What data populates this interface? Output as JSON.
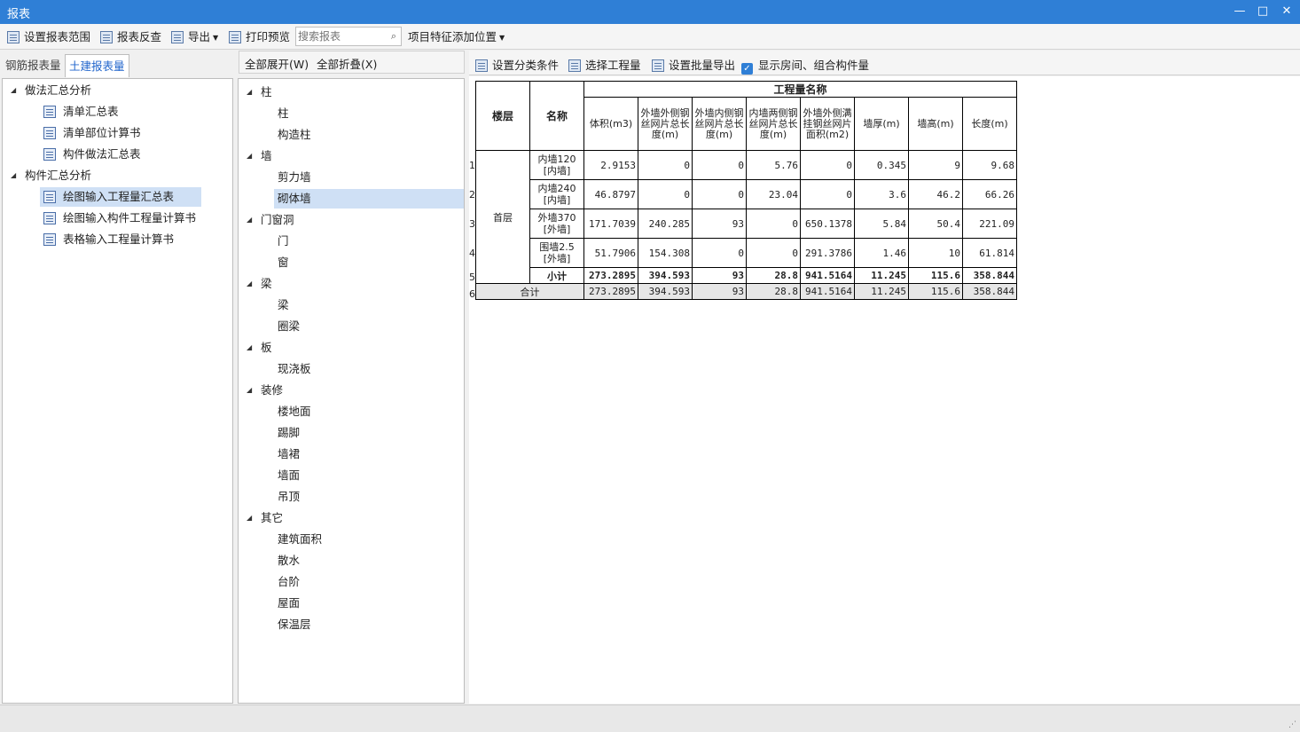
{
  "window": {
    "title": "报表",
    "minimize": "—",
    "maximize": "□",
    "close": "✕"
  },
  "toolbar": {
    "set_range": "设置报表范围",
    "reverse": "报表反查",
    "export": "导出",
    "print_preview": "打印预览",
    "search_placeholder": "搜索报表",
    "feature_position": "项目特征添加位置"
  },
  "left_tabs": {
    "tab1": "钢筋报表量",
    "tab2": "土建报表量"
  },
  "left_tree": {
    "group1": "做法汇总分析",
    "g1_items": [
      "清单汇总表",
      "清单部位计算书",
      "构件做法汇总表"
    ],
    "group2": "构件汇总分析",
    "g2_items": [
      "绘图输入工程量汇总表",
      "绘图输入构件工程量计算书",
      "表格输入工程量计算书"
    ]
  },
  "mid": {
    "expand_all": "全部展开(W)",
    "collapse_all": "全部折叠(X)",
    "tree": [
      {
        "label": "柱",
        "children": [
          "柱",
          "构造柱"
        ]
      },
      {
        "label": "墙",
        "children": [
          "剪力墙",
          "砌体墙"
        ]
      },
      {
        "label": "门窗洞",
        "children": [
          "门",
          "窗"
        ]
      },
      {
        "label": "梁",
        "children": [
          "梁",
          "圈梁"
        ]
      },
      {
        "label": "板",
        "children": [
          "现浇板"
        ]
      },
      {
        "label": "装修",
        "children": [
          "楼地面",
          "踢脚",
          "墙裙",
          "墙面",
          "吊顶"
        ]
      },
      {
        "label": "其它",
        "children": [
          "建筑面积",
          "散水",
          "台阶",
          "屋面",
          "保温层"
        ]
      }
    ]
  },
  "right_toolbar": {
    "classify": "设置分类条件",
    "select_qty": "选择工程量",
    "batch_export": "设置批量导出",
    "show_rooms": "显示房间、组合构件量"
  },
  "report": {
    "h_floor": "楼层",
    "h_name": "名称",
    "h_group": "工程量名称",
    "cols": [
      "体积(m3)",
      "外墙外侧钢丝网片总长度(m)",
      "外墙内侧钢丝网片总长度(m)",
      "内墙两侧钢丝网片总长度(m)",
      "外墙外侧满挂钢丝网片面积(m2)",
      "墙厚(m)",
      "墙高(m)",
      "长度(m)"
    ],
    "floor": "首层",
    "rows": [
      {
        "n": "1",
        "name": "内墙120 [内墙]",
        "v": [
          "2.9153",
          "0",
          "0",
          "5.76",
          "0",
          "0.345",
          "9",
          "9.68"
        ]
      },
      {
        "n": "2",
        "name": "内墙240 [内墙]",
        "v": [
          "46.8797",
          "0",
          "0",
          "23.04",
          "0",
          "3.6",
          "46.2",
          "66.26"
        ]
      },
      {
        "n": "3",
        "name": "外墙370 [外墙]",
        "v": [
          "171.7039",
          "240.285",
          "93",
          "0",
          "650.1378",
          "5.84",
          "50.4",
          "221.09"
        ]
      },
      {
        "n": "4",
        "name": "围墙2.5 [外墙]",
        "v": [
          "51.7906",
          "154.308",
          "0",
          "0",
          "291.3786",
          "1.46",
          "10",
          "61.814"
        ]
      }
    ],
    "subtotal": {
      "n": "5",
      "label": "小计",
      "v": [
        "273.2895",
        "394.593",
        "93",
        "28.8",
        "941.5164",
        "11.245",
        "115.6",
        "358.844"
      ]
    },
    "total": {
      "n": "6",
      "label": "合计",
      "v": [
        "273.2895",
        "394.593",
        "93",
        "28.8",
        "941.5164",
        "11.245",
        "115.6",
        "358.844"
      ]
    }
  }
}
